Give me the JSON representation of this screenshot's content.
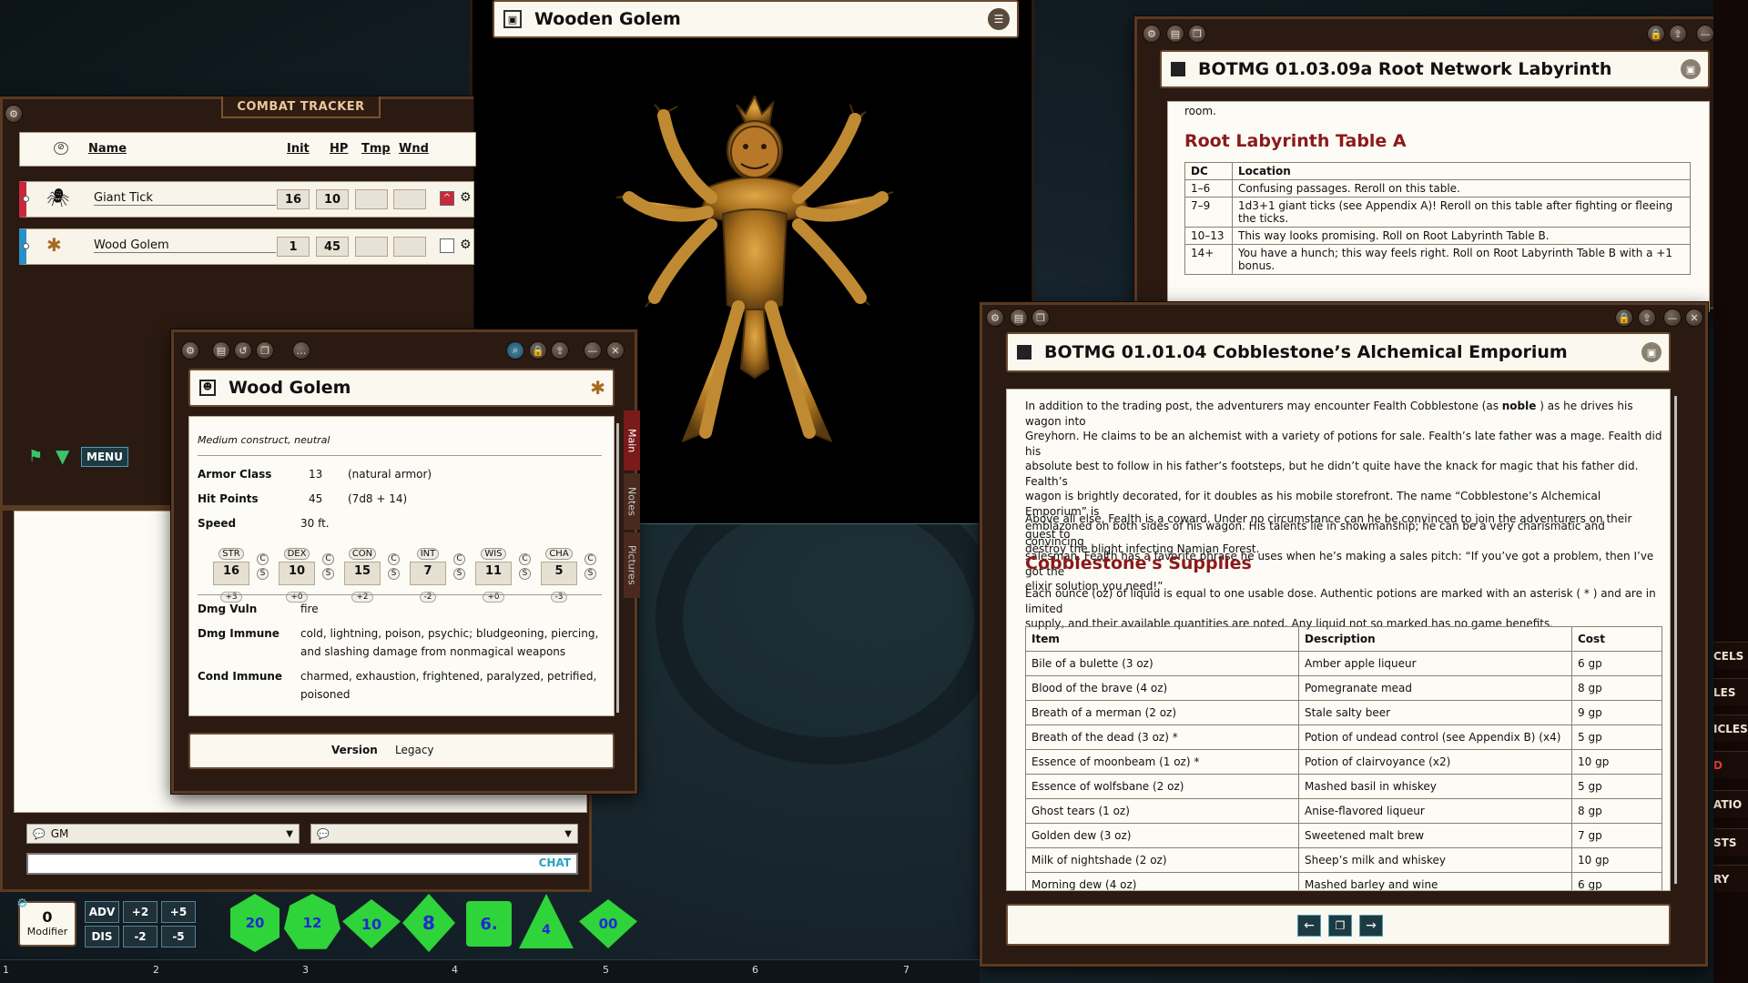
{
  "combat_tracker": {
    "title": "COMBAT TRACKER",
    "headers": {
      "name": "Name",
      "init": "Init",
      "hp": "HP",
      "tmp": "Tmp",
      "wnd": "Wnd"
    },
    "rows": [
      {
        "name": "Giant Tick",
        "init": "16",
        "hp": "10",
        "tmp": "",
        "wnd": ""
      },
      {
        "name": "Wood Golem",
        "init": "1",
        "hp": "45",
        "tmp": "",
        "wnd": ""
      }
    ],
    "menu_label": "MENU"
  },
  "image_window": {
    "title": "Wooden Golem"
  },
  "stat_block": {
    "title": "Wood Golem",
    "subtitle": "Medium construct, neutral",
    "armor_class": {
      "label": "Armor Class",
      "value": "13",
      "note": "(natural armor)"
    },
    "hit_points": {
      "label": "Hit Points",
      "value": "45",
      "note": "(7d8 + 14)"
    },
    "speed": {
      "label": "Speed",
      "value": "30 ft."
    },
    "abilities": [
      {
        "name": "STR",
        "score": "16",
        "mod": "+3"
      },
      {
        "name": "DEX",
        "score": "10",
        "mod": "+0"
      },
      {
        "name": "CON",
        "score": "15",
        "mod": "+2"
      },
      {
        "name": "INT",
        "score": "7",
        "mod": "-2"
      },
      {
        "name": "WIS",
        "score": "11",
        "mod": "+0"
      },
      {
        "name": "CHA",
        "score": "5",
        "mod": "-3"
      }
    ],
    "save_check": {
      "c": "C",
      "s": "S"
    },
    "dmg_vuln": {
      "label": "Dmg Vuln",
      "value": "fire"
    },
    "dmg_immune": {
      "label": "Dmg Immune",
      "line1": "cold, lightning, poison, psychic; bludgeoning, piercing,",
      "line2": "and slashing damage from nonmagical weapons"
    },
    "cond_immune": {
      "label": "Cond Immune",
      "line1": "charmed, exhaustion, frightened, paralyzed, petrified,",
      "line2": "poisoned"
    },
    "tabs": [
      "Main",
      "Notes",
      "Pictures"
    ],
    "version_label": "Version",
    "version_value": "Legacy"
  },
  "chat": {
    "identity": "GM",
    "send_label": "CHAT"
  },
  "modifier": {
    "value": "0",
    "label": "Modifier"
  },
  "mod_buttons": [
    "ADV",
    "+2",
    "+5",
    "DIS",
    "-2",
    "-5"
  ],
  "dice": [
    "20",
    "12",
    "10",
    "8",
    "6.",
    "4",
    "00"
  ],
  "hotkeys": [
    "1",
    "2",
    "3",
    "4",
    "5",
    "6",
    "7"
  ],
  "root_window": {
    "title": "BOTMG 01.03.09a Root Network Labyrinth",
    "snippet": "room.",
    "heading": "Root Labyrinth Table A",
    "headers": [
      "DC",
      "Location"
    ],
    "rows": [
      [
        "1–6",
        "Confusing passages. Reroll on this table."
      ],
      [
        "7–9",
        "1d3+1 giant ticks (see Appendix A)! Reroll on this table after fighting or fleeing the ticks."
      ],
      [
        "10–13",
        "This way looks promising. Roll on Root Labyrinth Table B."
      ],
      [
        "14+",
        "You have a hunch; this way feels right. Roll on Root Labyrinth Table B with a +1 bonus."
      ]
    ]
  },
  "emporium_window": {
    "title": "BOTMG 01.01.04 Cobblestone’s Alchemical Emporium",
    "para1_lines": [
      "In addition to the trading post, the adventurers may encounter Fealth Cobblestone (as ",
      "Greyhorn. He claims to be an alchemist with a variety of potions for sale. Fealth’s late father was a mage. Fealth did his",
      "absolute best to follow in his father’s footsteps, but he didn’t quite have the knack for magic that his father did. Fealth’s",
      "wagon is brightly decorated, for it doubles as his mobile storefront. The name “Cobblestone’s Alchemical Emporium” is",
      "emblazoned on both sides of his wagon. His talents lie in showmanship; he can be a very charismatic and convincing",
      "salesman. Fealth has a favorite phrase he uses when he’s making a sales pitch: “If you’ve got a problem, then I’ve got the",
      "elixir solution you need!”"
    ],
    "para1_bold": "noble",
    "para1_tail": " ) as he drives his wagon into",
    "para2_lines": [
      "Above all else, Fealth is a coward. Under no circumstance can he be convinced to join the adventurers on their quest to",
      "destroy the blight infecting Namjan Forest."
    ],
    "heading": "Cobblestone's Supplies",
    "para3_lines": [
      "Each ounce (oz) of liquid is equal to one usable dose. Authentic potions are marked with an asterisk ( * ) and are in limited",
      "supply, and their available quantities are noted. Any liquid not so marked has no game benefits."
    ],
    "table_headers": [
      "Item",
      "Description",
      "Cost"
    ],
    "table_rows": [
      [
        "Bile of a bulette (3 oz)",
        "Amber apple liqueur",
        "6 gp"
      ],
      [
        "Blood of the brave (4 oz)",
        "Pomegranate mead",
        "8 gp"
      ],
      [
        "Breath of a merman (2 oz)",
        "Stale salty beer",
        "9 gp"
      ],
      [
        "Breath of the dead (3 oz) *",
        "Potion of undead control (see Appendix B) (x4)",
        "5 gp"
      ],
      [
        "Essence of moonbeam (1 oz) *",
        "Potion of clairvoyance (x2)",
        "10 gp"
      ],
      [
        "Essence of wolfsbane (2 oz)",
        "Mashed basil in whiskey",
        "5 gp"
      ],
      [
        "Ghost tears (1 oz)",
        "Anise-flavored liqueur",
        "8 gp"
      ],
      [
        "Golden dew (3 oz)",
        "Sweetened malt brew",
        "7 gp"
      ],
      [
        "Milk of nightshade (2 oz)",
        "Sheep’s milk and whiskey",
        "10 gp"
      ],
      [
        "Morning dew (4 oz)",
        "Mashed barley and wine",
        "6 gp"
      ]
    ]
  },
  "right_sidebar": [
    "CELS",
    "LES",
    "ICLES",
    "D",
    "ATIO",
    "STS",
    "RY"
  ],
  "colors": {
    "accent_red": "#8b1a1a",
    "dice_green": "#2fd33a",
    "frame_brown": "#5a3a22"
  }
}
